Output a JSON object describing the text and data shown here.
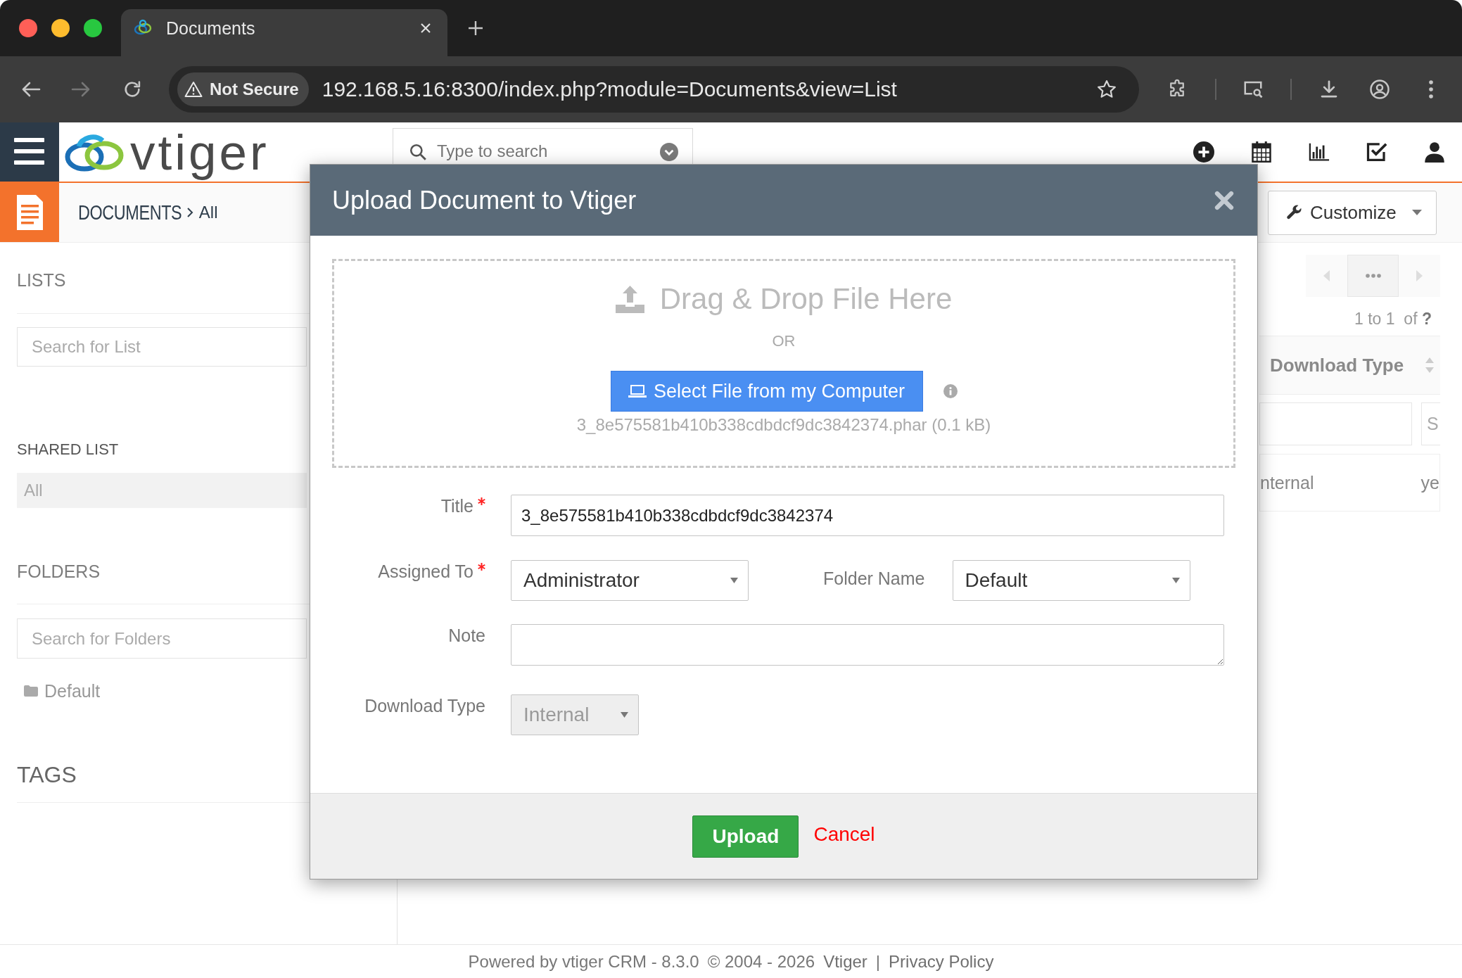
{
  "browser": {
    "tabs": [
      {
        "title": "Documents",
        "selected": true
      }
    ],
    "security_label": "Not Secure",
    "url": "192.168.5.16:8300/index.php?module=Documents&view=List"
  },
  "header": {
    "logo_text": "vtiger",
    "search": {
      "placeholder": "Type to search"
    }
  },
  "module_bar": {
    "module": "DOCUMENTS",
    "view": "All",
    "customize": "Customize"
  },
  "sidebar": {
    "lists": {
      "heading": "LISTS",
      "search": {
        "placeholder": "Search for List"
      }
    },
    "shared_list": {
      "heading": "SHARED LIST",
      "items": [
        {
          "label": "All",
          "selected": true
        }
      ]
    },
    "folders": {
      "heading": "FOLDERS",
      "search": {
        "placeholder": "Search for Folders"
      },
      "items": [
        {
          "label": "Default"
        }
      ]
    },
    "tags": {
      "heading": "TAGS"
    }
  },
  "list_view": {
    "pagination": {
      "previous": {
        "disabled": true
      },
      "next": {
        "disabled": true
      }
    },
    "range": "1 to 1  of **?**",
    "columns": [
      {
        "label": "Download Type"
      }
    ],
    "filter_row": {
      "button": "S"
    },
    "rows": [
      {
        "cells": [
          "nternal",
          "ye"
        ]
      }
    ]
  },
  "modal": {
    "title": "Upload Document to Vtiger",
    "dropzone": {
      "heading": "Drag & Drop File Here",
      "separator": "OR",
      "button": "Select File from my Computer",
      "file": "3_8e575581b410b338cdbdcf9dc3842374.phar (0.1 kB)"
    },
    "rows": [
      {
        "fields": [
          {
            "kind": "text",
            "label": "Title",
            "required": true,
            "disabled": false,
            "value": "3_8e575581b410b338cdbdcf9dc3842374"
          }
        ]
      },
      {
        "fields": [
          {
            "kind": "select",
            "label": "Assigned To",
            "required": true,
            "disabled": false,
            "value": "Administrator"
          },
          {
            "kind": "select",
            "label": "Folder Name",
            "required": false,
            "disabled": false,
            "value": "Default"
          }
        ]
      },
      {
        "fields": [
          {
            "kind": "textarea",
            "label": "Note",
            "required": false,
            "disabled": false
          }
        ]
      },
      {
        "fields": [
          {
            "kind": "select",
            "label": "Download Type",
            "required": false,
            "disabled": true,
            "value": "Internal"
          }
        ]
      }
    ],
    "buttons": {
      "submit": "Upload",
      "cancel": "Cancel"
    }
  },
  "footer": {
    "items": [
      {
        "kind": "text",
        "text": "Powered by vtiger CRM - 8.3.0"
      },
      {
        "kind": "text",
        "text": "© 2004 - 2026"
      },
      {
        "kind": "link",
        "text": "Vtiger"
      },
      {
        "kind": "text",
        "text": "|"
      },
      {
        "kind": "link",
        "text": "Privacy Policy"
      }
    ]
  }
}
